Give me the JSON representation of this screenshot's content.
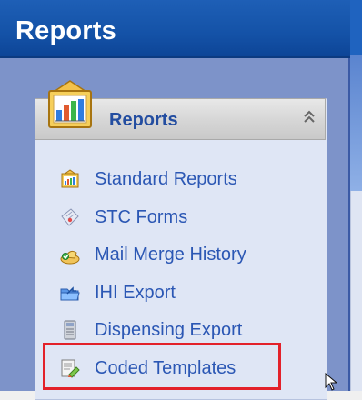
{
  "window": {
    "title": "Reports"
  },
  "panel": {
    "header_label": "Reports",
    "collapse_glyph": "⌃⌃"
  },
  "items": [
    {
      "label": "Standard Reports",
      "icon": "standard-reports-icon"
    },
    {
      "label": "STC Forms",
      "icon": "stc-forms-icon"
    },
    {
      "label": "Mail Merge History",
      "icon": "mail-merge-icon"
    },
    {
      "label": "IHI Export",
      "icon": "ihi-export-icon"
    },
    {
      "label": "Dispensing Export",
      "icon": "dispensing-export-icon"
    },
    {
      "label": "Coded Templates",
      "icon": "coded-templates-icon"
    }
  ],
  "colors": {
    "title_bar": "#1452a7",
    "link_text": "#2b57b4",
    "highlight": "#e3212a"
  }
}
